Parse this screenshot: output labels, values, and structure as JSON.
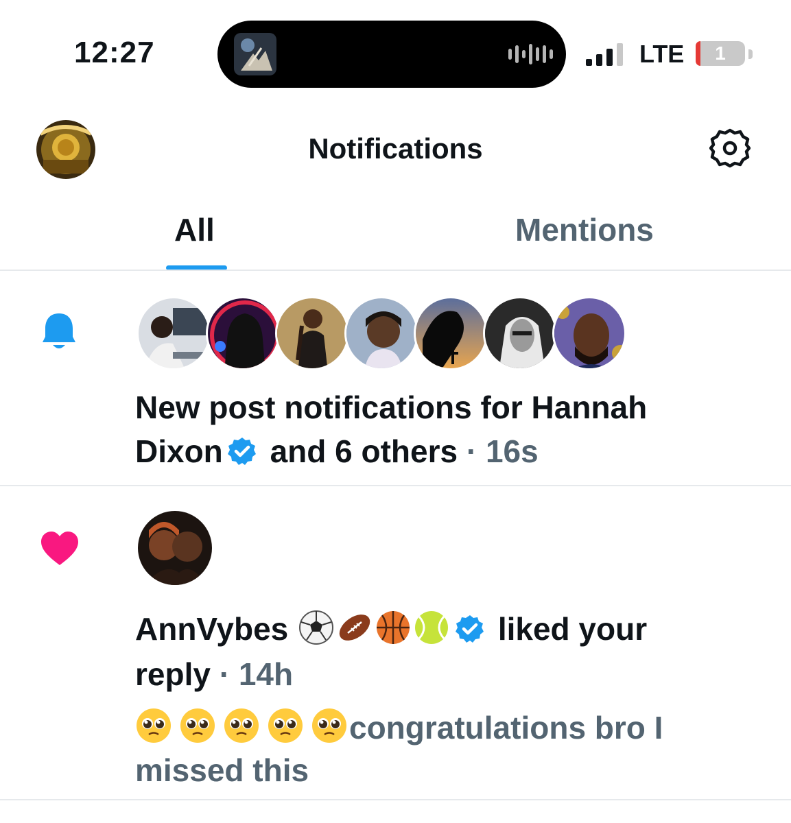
{
  "status_bar": {
    "time": "12:27",
    "network": "LTE",
    "battery_level": "1",
    "signal_bars_active": 3
  },
  "header": {
    "title": "Notifications",
    "settings_icon": "gear-icon"
  },
  "tabs": [
    {
      "label": "All",
      "selected": true
    },
    {
      "label": "Mentions",
      "selected": false
    }
  ],
  "notifications": [
    {
      "type": "new-post",
      "icon": "bell-icon",
      "avatar_count": 7,
      "text_line1": "New post notifications for Hannah",
      "text_name": "Dixon",
      "text_rest": "and 6 others",
      "separator": "·",
      "time": "16s"
    },
    {
      "type": "like",
      "icon": "heart-icon",
      "user": "AnnVybes",
      "action_line1": "liked your",
      "action_line2": "reply",
      "separator": "·",
      "time": "14h",
      "reply_line1": "congratulations bro I",
      "reply_line2": "missed this"
    }
  ],
  "colors": {
    "accent": "#1d9bf0",
    "like": "#f91880",
    "muted": "#536471",
    "text": "#0f1419"
  }
}
